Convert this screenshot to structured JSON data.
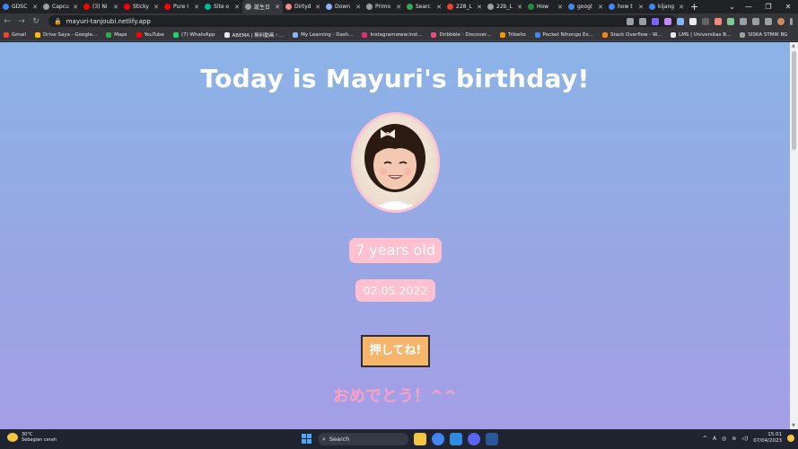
{
  "tabs": [
    {
      "label": "GDSC",
      "color": "#4285f4"
    },
    {
      "label": "Capcu",
      "color": "#9aa0a6"
    },
    {
      "label": "(3) Ni",
      "color": "#ff0000"
    },
    {
      "label": "Sticky",
      "color": "#ff0000"
    },
    {
      "label": "Pure I",
      "color": "#ff0000"
    },
    {
      "label": "Site o",
      "color": "#00b89c"
    },
    {
      "label": "誕生日",
      "color": "#9aa0a6",
      "active": true
    },
    {
      "label": "Dirtyd",
      "color": "#f28b82"
    },
    {
      "label": "Down",
      "color": "#8ab4f8"
    },
    {
      "label": "Primo",
      "color": "#9aa0a6"
    },
    {
      "label": "Searc",
      "color": "#34a853"
    },
    {
      "label": "228_L",
      "color": "#ea4335"
    },
    {
      "label": "22b_L",
      "color": "#9aa0a6"
    },
    {
      "label": "How",
      "color": "#1e8e3e"
    },
    {
      "label": "googl",
      "color": "#4285f4"
    },
    {
      "label": "how t",
      "color": "#4285f4"
    },
    {
      "label": "kijang",
      "color": "#4285f4"
    }
  ],
  "omnibox": {
    "url": "mayuri-tanjoubi.netlify.app"
  },
  "bookmarks": [
    {
      "label": "Gmail",
      "color": "#ea4335"
    },
    {
      "label": "Drive Saya - Google...",
      "color": "#fbbc04"
    },
    {
      "label": "Maps",
      "color": "#34a853"
    },
    {
      "label": "YouTube",
      "color": "#ff0000"
    },
    {
      "label": "(7) WhatsApp",
      "color": "#25d366"
    },
    {
      "label": "ABEMA | 無料動画・...",
      "color": "#e8eaed"
    },
    {
      "label": "My Learning - Dash...",
      "color": "#8ab4f8"
    },
    {
      "label": "Instagramwww.inst...",
      "color": "#e1306c"
    },
    {
      "label": "Dribbble - Discover...",
      "color": "#ea4c89"
    },
    {
      "label": "Tribelio",
      "color": "#f29900"
    },
    {
      "label": "Pocket Nihongo Ex...",
      "color": "#4285f4"
    },
    {
      "label": "Stack Overflow - W...",
      "color": "#f48024"
    },
    {
      "label": "LMS | Universitas B...",
      "color": "#e8eaed"
    },
    {
      "label": "SISKA STMIK BG",
      "color": "#9aa0a6"
    }
  ],
  "page": {
    "headline": "Today is Mayuri's birthday!",
    "age": "7 years old",
    "date": "02.05.2022",
    "button_label": "押してね!",
    "congrats": "おめでとう！^^"
  },
  "taskbar": {
    "weather_temp": "30°C",
    "weather_desc": "Sebagian cerah",
    "search_label": "Search",
    "time": "15.01",
    "date": "07/04/2023"
  }
}
